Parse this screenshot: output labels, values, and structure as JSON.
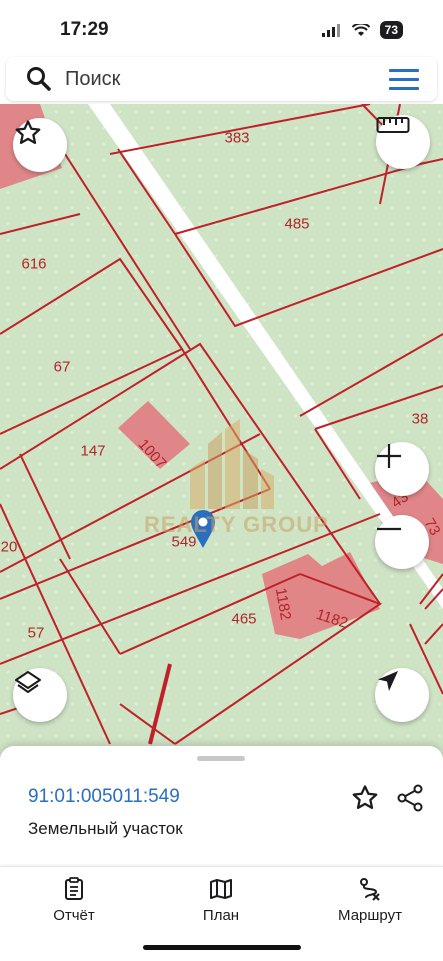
{
  "status": {
    "time": "17:29",
    "battery": "73"
  },
  "search": {
    "placeholder": "Поиск"
  },
  "map": {
    "parcels": [
      {
        "id": "p383",
        "label": "383"
      },
      {
        "id": "p485",
        "label": "485"
      },
      {
        "id": "p616",
        "label": "616"
      },
      {
        "id": "p67",
        "label": "67"
      },
      {
        "id": "p147",
        "label": "147"
      },
      {
        "id": "p549",
        "label": "549"
      },
      {
        "id": "p465",
        "label": "465"
      },
      {
        "id": "p57",
        "label": "57"
      },
      {
        "id": "p20",
        "label": "20"
      },
      {
        "id": "p38",
        "label": "38"
      },
      {
        "id": "p1007",
        "label": "1007"
      },
      {
        "id": "p1182a",
        "label": "1182"
      },
      {
        "id": "p1182b",
        "label": "1182"
      },
      {
        "id": "p43",
        "label": "43"
      },
      {
        "id": "p73",
        "label": "73"
      }
    ],
    "watermark": "REALTY GROUP"
  },
  "controls": {
    "favorite": "star-icon",
    "ruler": "ruler-icon",
    "zoom_in": "plus-icon",
    "zoom_out": "minus-icon",
    "layers": "layers-icon",
    "locate": "navigation-arrow-icon"
  },
  "sheet": {
    "cadastral_number": "91:01:005011:549",
    "type": "Земельный участок"
  },
  "tabs": [
    {
      "label": "Отчёт",
      "icon": "report-icon"
    },
    {
      "label": "План",
      "icon": "map-plan-icon"
    },
    {
      "label": "Маршрут",
      "icon": "route-icon"
    }
  ],
  "colors": {
    "accent": "#2a6fbf",
    "parcel_border": "#c0202a",
    "map_bg": "#cfe3c5",
    "building": "#e3767c"
  }
}
